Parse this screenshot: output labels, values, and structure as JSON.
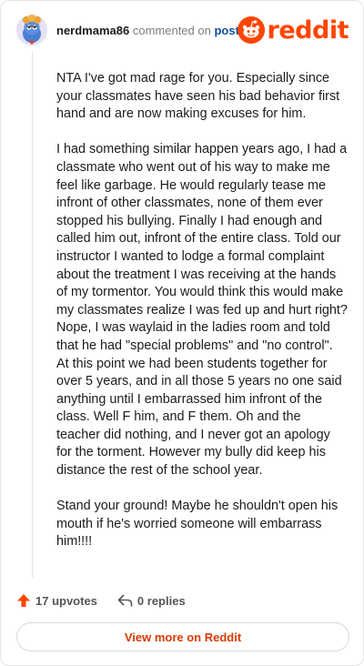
{
  "header": {
    "username": "nerdmama86",
    "action_text": "commented on",
    "post_link": "post",
    "logo_text": "reddit",
    "brand_color": "#ff4500",
    "avatar_icon": "snoo-avatar-icon"
  },
  "comment": {
    "paragraphs": [
      "NTA I've got mad rage for you. Especially since your classmates have seen his bad behavior first hand and are now making excuses for him.",
      "I had something similar happen years ago, I had a classmate who went out of his way to make me feel like garbage. He would regularly tease me infront of other classmates, none of them ever stopped his bullying. Finally I had enough and called him out, infront of the entire class. Told our instructor I wanted to lodge a formal complaint about the treatment I was receiving at the hands of my tormentor. You would think this would make my classmates realize I was fed up and hurt right? Nope, I was waylaid in the ladies room and told that he had \"special problems\" and \"no control\". At this point we had been students together for over 5 years, and in all those 5 years no one said anything until I embarrassed him infront of the class. Well F him, and F them. Oh and the teacher did nothing, and I never got an apology for the torment. However my bully did keep his distance the rest of the school year.",
      "Stand your ground! Maybe he shouldn't open his mouth if he's worried someone will embarrass him!!!!"
    ]
  },
  "actions": {
    "upvotes": "17 upvotes",
    "replies": "0 replies",
    "upvote_color": "#ff4500"
  },
  "footer": {
    "view_more": "View more on Reddit",
    "view_more_color": "#d93a00"
  }
}
